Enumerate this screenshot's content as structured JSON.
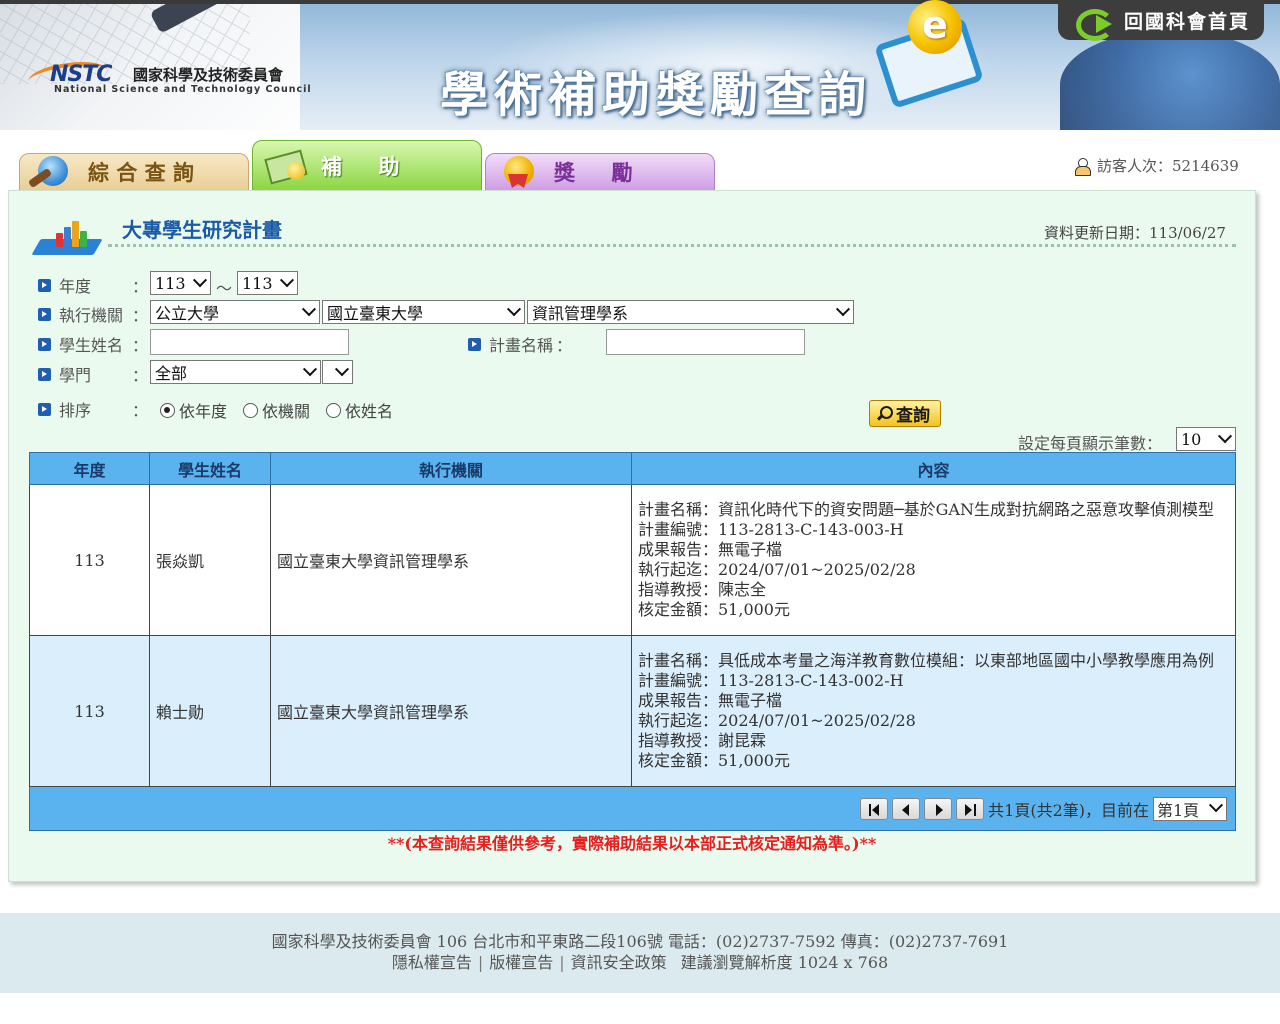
{
  "header": {
    "logo_abbr": "NSTC",
    "logo_cn": "國家科學及技術委員會",
    "logo_en": "National Science and Technology Council",
    "site_title": "學術補助獎勵查詢",
    "home_link": "回國科會首頁"
  },
  "tabs": [
    {
      "label": "綜 合 查 詢",
      "icon": "globe-search-icon",
      "active": false
    },
    {
      "label": "補     助",
      "icon": "money-icon",
      "active": true
    },
    {
      "label": "獎     勵",
      "icon": "medal-icon",
      "active": false
    }
  ],
  "visitor": {
    "text": "訪客人次：5214639",
    "icon": "user-icon"
  },
  "panel": {
    "title": "大專學生研究計畫",
    "update_date": "資料更新日期：113/06/27"
  },
  "form": {
    "year_label": "年度",
    "year_from": "113",
    "year_tilde": "～",
    "year_to": "113",
    "institution_label": "執行機關",
    "institution_type": "公立大學",
    "institution": "國立臺東大學",
    "department": "資訊管理學系",
    "student_label": "學生姓名",
    "student_value": "",
    "project_label": "計畫名稱",
    "project_value": "",
    "discipline_label": "學門",
    "discipline": "全部",
    "discipline_sub": "",
    "sort_label": "排序",
    "sort_options": [
      "依年度",
      "依機關",
      "依姓名"
    ],
    "sort_selected": 0,
    "query_button": "查詢",
    "per_page_label": "設定每頁顯示筆數：",
    "per_page": "10",
    "colon": "："
  },
  "table": {
    "headers": [
      "年度",
      "學生姓名",
      "執行機關",
      "內容"
    ],
    "rows": [
      {
        "year": "113",
        "name": "張焱凱",
        "institution": "國立臺東大學資訊管理學系",
        "content": [
          "計畫名稱：資訊化時代下的資安問題─基於GAN生成對抗網路之惡意攻擊偵測模型",
          "計畫編號：113-2813-C-143-003-H",
          "成果報告：無電子檔",
          "執行起迄：2024/07/01~2025/02/28",
          "指導教授：陳志全",
          "核定金額：51,000元"
        ]
      },
      {
        "year": "113",
        "name": "賴士勛",
        "institution": "國立臺東大學資訊管理學系",
        "content": [
          "計畫名稱：具低成本考量之海洋教育數位模組：以東部地區國中小學教學應用為例",
          "計畫編號：113-2813-C-143-002-H",
          "成果報告：無電子檔",
          "執行起迄：2024/07/01~2025/02/28",
          "指導教授：謝昆霖",
          "核定金額：51,000元"
        ]
      }
    ],
    "pager": {
      "summary": "共1頁(共2筆)，目前在",
      "current_page": "第1頁"
    }
  },
  "disclaimer": "**(本查詢結果僅供參考，實際補助結果以本部正式核定通知為準。)**",
  "footer": {
    "line1": "國家科學及技術委員會  106  台北市和平東路二段106號  電話：(02)2737-7592  傳真：(02)2737-7691",
    "links": [
      "隱私權宣告",
      "版權宣告",
      "資訊安全政策"
    ],
    "link_sep": "|",
    "resolution": "建議瀏覽解析度 1024 x 768"
  }
}
